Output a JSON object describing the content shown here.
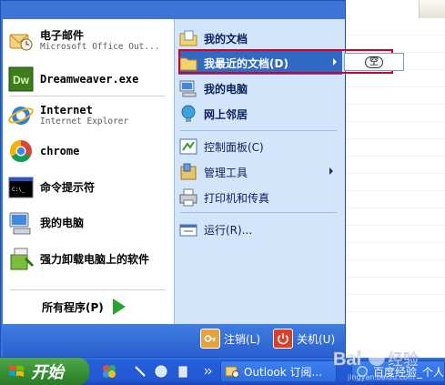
{
  "pinned": [
    {
      "label": "电子邮件",
      "sub": "Microsoft Office Out...",
      "icon": "outlook-icon"
    },
    {
      "label": "Dreamweaver.exe",
      "sub": "",
      "icon": "dreamweaver-icon"
    }
  ],
  "recent": [
    {
      "label": "Internet",
      "sub": "Internet Explorer",
      "icon": "internet-explorer-icon"
    },
    {
      "label": "chrome",
      "sub": "",
      "icon": "chrome-icon"
    },
    {
      "label": "命令提示符",
      "sub": "",
      "icon": "command-prompt-icon"
    },
    {
      "label": "我的电脑",
      "sub": "",
      "icon": "computer-icon"
    },
    {
      "label": "强力卸载电脑上的软件",
      "sub": "",
      "icon": "uninstall-icon"
    }
  ],
  "all_programs": {
    "label": "所有程序(P)"
  },
  "right": {
    "my_documents": "我的文档",
    "recent_documents": "我最近的文档(D)",
    "my_computer": "我的电脑",
    "network_places": "网上邻居",
    "control_panel": "控制面板(C)",
    "admin_tools": "管理工具",
    "printers": "打印机和传真",
    "run": "运行(R)..."
  },
  "submenu": {
    "item": "空"
  },
  "footer": {
    "logoff": "注销(L)",
    "shutdown": "关机(U)"
  },
  "taskbar": {
    "start_label": "开始",
    "tasks": [
      "Outlook 订阅...",
      "百度经验_个人"
    ]
  },
  "watermark": {
    "text": "Bai百度经验",
    "sub": "jingyan.baidu.com"
  },
  "colors": {
    "menu_blue": "#3d74d6",
    "selected": "#316ac5",
    "highlight_box": "#d4002a",
    "start_green": "#358d31"
  }
}
